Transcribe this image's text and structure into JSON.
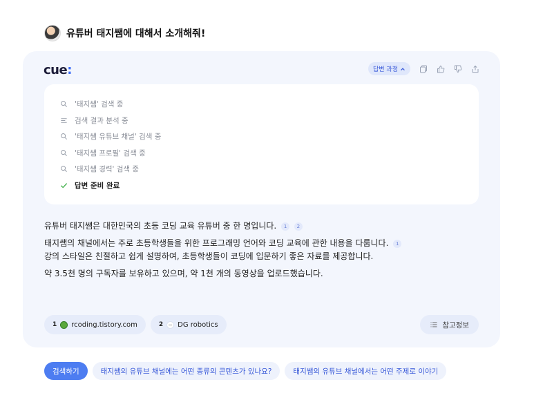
{
  "question": {
    "text": "유튜버 태지쌤에 대해서 소개해줘!",
    "avatar_icon": "user-avatar"
  },
  "card": {
    "logo": {
      "main": "cue",
      "suffix": ":"
    },
    "toolbar": {
      "process_label": "답변 과정",
      "icons": [
        "copy-icon",
        "thumbs-up-icon",
        "thumbs-down-icon",
        "share-icon"
      ]
    },
    "steps": [
      {
        "icon": "search-icon",
        "text": "'태지쌤' 검색 중"
      },
      {
        "icon": "list-icon",
        "text": "검색 결과 분석 중"
      },
      {
        "icon": "search-icon",
        "text": "'태지쌤 유튜브 채널' 검색 중"
      },
      {
        "icon": "search-icon",
        "text": "'태지쌤 프로필' 검색 중"
      },
      {
        "icon": "search-icon",
        "text": "'태지쌤 경력' 검색 중"
      },
      {
        "icon": "check-icon",
        "text": "답변 준비 완료"
      }
    ],
    "answer": {
      "p1": "유튜버 태지쌤은 대한민국의 초등 코딩 교육 유튜버 중 한 명입니다.",
      "p1_cites": [
        "1",
        "2"
      ],
      "p2_line1": "태지쌤의 채널에서는 주로 초등학생들을 위한 프로그래밍 언어와 코딩 교육에 관한 내용을 다룹니다.",
      "p2_cite": "1",
      "p2_line2": "강의 스타일은 친절하고 쉽게 설명하여, 초등학생들이 코딩에 입문하기 좋은 자료를 제공합니다.",
      "p3": "약 3.5천 명의 구독자를 보유하고 있으며, 약 1천 개의 동영상을 업로드했습니다."
    },
    "sources": [
      {
        "num": "1",
        "label": "rcoding.tistory.com"
      },
      {
        "num": "2",
        "label": "DG robotics"
      }
    ],
    "ref_label": "참고정보"
  },
  "suggestions": [
    "검색하기",
    "태지쌤의 유튜브 채널에는 어떤 종류의 콘텐츠가 있나요?",
    "태지쌤의 유튜브 채널에서는 어떤 주제로 이야기"
  ],
  "colors": {
    "accent": "#4d7df1",
    "card_bg": "#f3f6fd",
    "check": "#3fae49"
  }
}
